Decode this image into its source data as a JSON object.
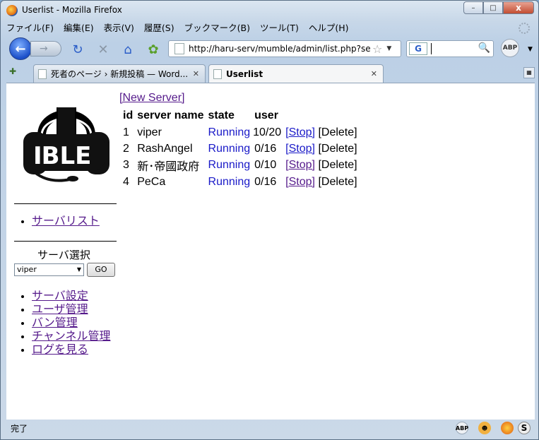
{
  "window": {
    "title": "Userlist - Mozilla Firefox",
    "minimize": "–",
    "maximize": "□",
    "close": "x"
  },
  "menu": [
    "ファイル(F)",
    "編集(E)",
    "表示(V)",
    "履歴(S)",
    "ブックマーク(B)",
    "ツール(T)",
    "ヘルプ(H)"
  ],
  "nav": {
    "url": "http://haru-serv/mumble/admin/list.php?sess",
    "search_engine": "G",
    "abp": "ABP"
  },
  "tabs": [
    {
      "label": "死者のページ › 新規投稿 — Word..."
    },
    {
      "label": "Userlist"
    }
  ],
  "sidebar": {
    "server_list_link": "サーバリスト",
    "server_select_label": "サーバ選択",
    "selected_server": "viper",
    "go_button": "GO",
    "links": [
      "サーバ設定",
      "ユーザ管理",
      "バン管理",
      "チャンネル管理",
      "ログを見る"
    ]
  },
  "main": {
    "new_server": "[New Server]",
    "headers": [
      "id",
      "server name",
      "state",
      "user"
    ],
    "rows": [
      {
        "id": "1",
        "name": "viper",
        "state": "Running",
        "user": "10/20",
        "stop": "[Stop]",
        "delete": "[Delete]"
      },
      {
        "id": "2",
        "name": "RashAngel",
        "state": "Running",
        "user": "0/16",
        "stop": "[Stop]",
        "delete": "[Delete]"
      },
      {
        "id": "3",
        "name": "新･帝國政府",
        "state": "Running",
        "user": "0/10",
        "stop": "[Stop]",
        "delete": "[Delete]"
      },
      {
        "id": "4",
        "name": "PeCa",
        "state": "Running",
        "user": "0/16",
        "stop": "[Stop]",
        "delete": "[Delete]"
      }
    ]
  },
  "status": {
    "text": "完了"
  },
  "colors": {
    "link_visited": "#551a8b",
    "running": "#1a1ac8"
  }
}
